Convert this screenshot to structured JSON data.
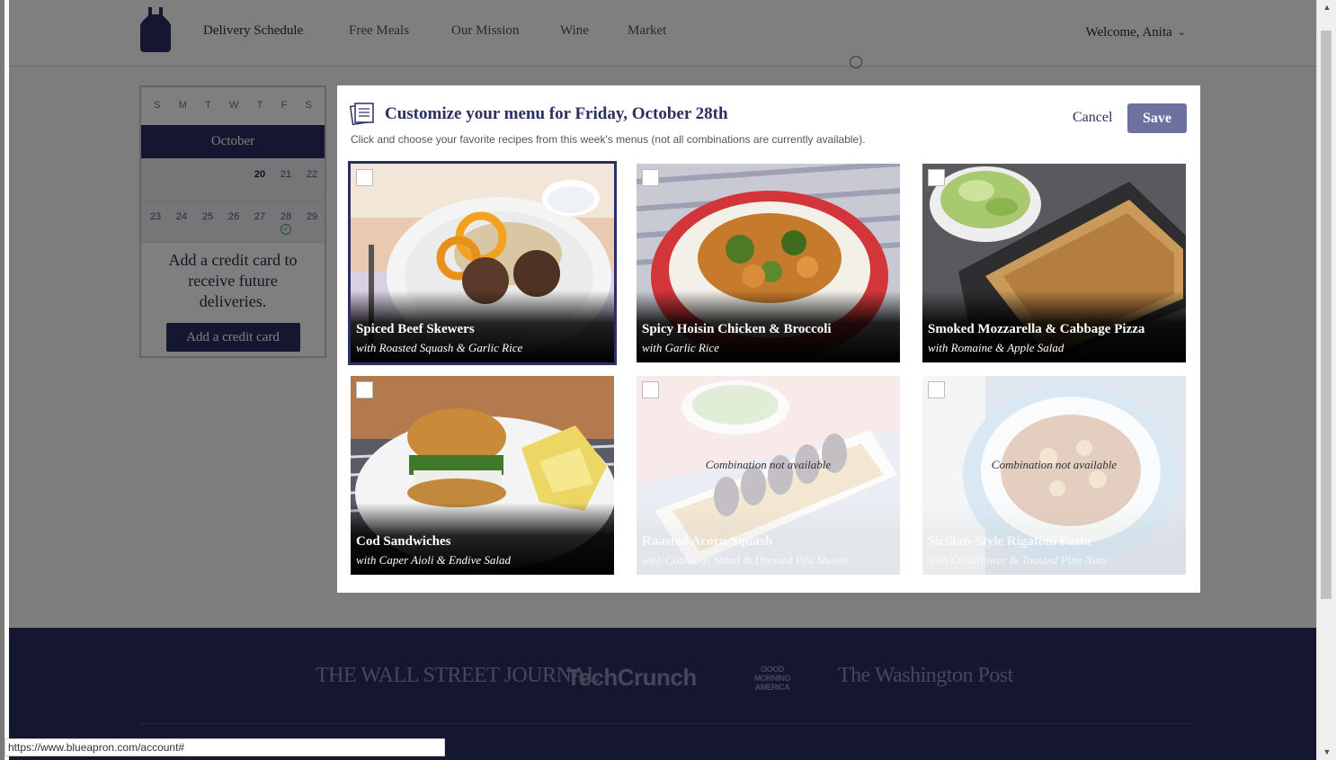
{
  "nav": {
    "items": [
      "Delivery Schedule",
      "Free Meals",
      "Our Mission",
      "Wine",
      "Market"
    ],
    "welcome": "Welcome, Anita"
  },
  "calendar": {
    "days": [
      "S",
      "M",
      "T",
      "W",
      "T",
      "F",
      "S"
    ],
    "month": "October",
    "week1": [
      "20",
      "21",
      "22"
    ],
    "week2": [
      "23",
      "24",
      "25",
      "26",
      "27",
      "28",
      "29"
    ],
    "cc_text": "Add a credit card to receive future deliveries.",
    "cc_button": "Add a credit card"
  },
  "modal": {
    "title": "Customize your menu for Friday, October 28th",
    "subtitle": "Click and choose your favorite recipes from this week's menus (not all combinations are currently available).",
    "cancel": "Cancel",
    "save": "Save",
    "unavailable_text": "Combination not available",
    "recipes": [
      {
        "name": "Spiced Beef Skewers",
        "with": "with Roasted Squash & Garlic Rice"
      },
      {
        "name": "Spicy Hoisin Chicken & Broccoli",
        "with": "with Garlic Rice"
      },
      {
        "name": "Smoked Mozzarella & Cabbage Pizza",
        "with": "with Romaine & Apple Salad"
      },
      {
        "name": "Cod Sandwiches",
        "with": "with Caper Aioli & Endive Salad"
      },
      {
        "name": "Roasted Acorn Squash",
        "with": "with Couscous Salad & Dressed Pea Shoots"
      },
      {
        "name": "Sicilian-Style Rigatoni Pasta",
        "with": "with Cauliflower & Toasted Pine Nuts"
      }
    ]
  },
  "footer": {
    "press": [
      "THE WALL STREET JOURNAL",
      "TechCrunch",
      "GOOD MORNING AMERICA",
      "The Washington Post"
    ]
  },
  "status_url": "https://www.blueapron.com/account#",
  "colors": {
    "brand": "#2b2f63",
    "save": "#6d71a0",
    "check": "#3aa05a"
  }
}
